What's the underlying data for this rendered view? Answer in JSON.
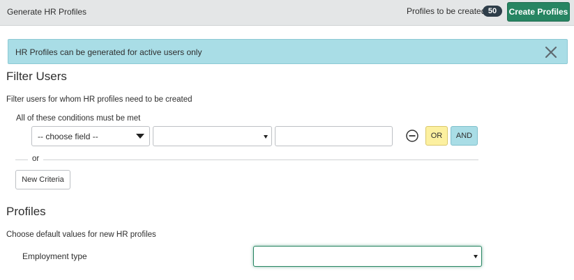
{
  "header": {
    "title": "Generate HR Profiles",
    "profiles_label": "Profiles to be created",
    "profiles_count": "50",
    "create_button": "Create Profiles",
    "create_button_color": "#278562"
  },
  "alert": {
    "message": "HR Profiles can be generated for active users only",
    "close_icon": "close-icon",
    "background_color": "#a9dde6"
  },
  "filter": {
    "title": "Filter Users",
    "description": "Filter users for whom HR profiles need to be created",
    "conditions_label": "All of these conditions must be met",
    "field_select_value": "-- choose field --",
    "operator_select_value": "",
    "value_input": "",
    "remove_icon": "minus-circle-icon",
    "or_button": "OR",
    "and_button": "AND",
    "or_separator": "or",
    "new_criteria_button": "New Criteria"
  },
  "profiles": {
    "title": "Profiles",
    "description": "Choose default values for new HR profiles",
    "employment_type_label": "Employment type",
    "employment_type_value": ""
  }
}
